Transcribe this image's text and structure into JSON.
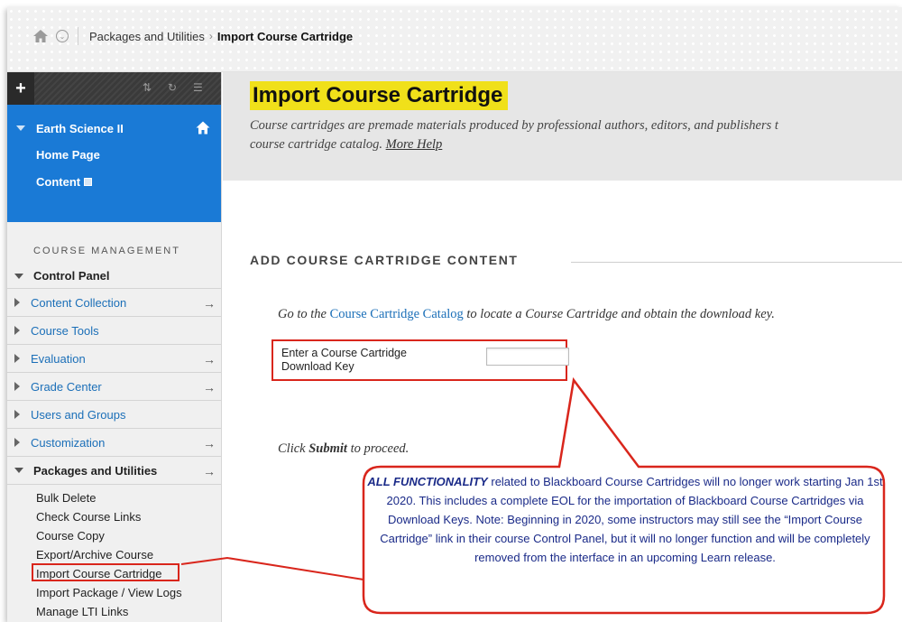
{
  "breadcrumb": {
    "parent": "Packages and Utilities",
    "separator": "›",
    "current": "Import Course Cartridge"
  },
  "sidebar": {
    "plus_label": "+",
    "course_title": "Earth Science II",
    "course_links": [
      "Home Page",
      "Content"
    ],
    "course_management_heading": "COURSE MANAGEMENT",
    "control_panel_label": "Control Panel",
    "panel_items": [
      {
        "label": "Content Collection",
        "has_arrow": true
      },
      {
        "label": "Course Tools",
        "has_arrow": false
      },
      {
        "label": "Evaluation",
        "has_arrow": true
      },
      {
        "label": "Grade Center",
        "has_arrow": true
      },
      {
        "label": "Users and Groups",
        "has_arrow": false
      },
      {
        "label": "Customization",
        "has_arrow": true
      }
    ],
    "packages_label": "Packages and Utilities",
    "arrow_glyph": "→",
    "sub_items": [
      "Bulk Delete",
      "Check Course Links",
      "Course Copy",
      "Export/Archive Course",
      "Import Course Cartridge",
      "Import Package / View Logs",
      "Manage LTI Links"
    ]
  },
  "main": {
    "title": "Import Course Cartridge",
    "description_line1": "Course cartridges are premade materials produced by professional authors, editors, and publishers t",
    "description_line2": "course cartridge catalog.",
    "more_help": "More Help",
    "section_heading": "ADD COURSE CARTRIDGE CONTENT",
    "goto_prefix": "Go to the",
    "catalog_link": "Course Cartridge Catalog",
    "goto_suffix": "to locate a Course Cartridge and obtain the download key.",
    "key_label": "Enter a Course Cartridge Download Key",
    "key_value": "",
    "submit_prefix": "Click",
    "submit_word": "Submit",
    "submit_suffix": "to proceed."
  },
  "callout": {
    "lead": "ALL FUNCTIONALITY",
    "text": "related to Blackboard Course Cartridges will no longer work starting Jan 1st 2020. This includes a complete EOL for the importation of Blackboard Course Cartridges via Download Keys. Note: Beginning in 2020, some instructors may still see the “Import Course Cartridge” link in their course Control Panel, but it will no longer function and will be completely removed from the interface in an upcoming Learn release."
  },
  "colors": {
    "course_blue": "#1a7ad6",
    "link_blue": "#1b6fb8",
    "title_highlight": "#f0e01a",
    "annotation_red": "#d9261c",
    "callout_text": "#1a2a88"
  }
}
